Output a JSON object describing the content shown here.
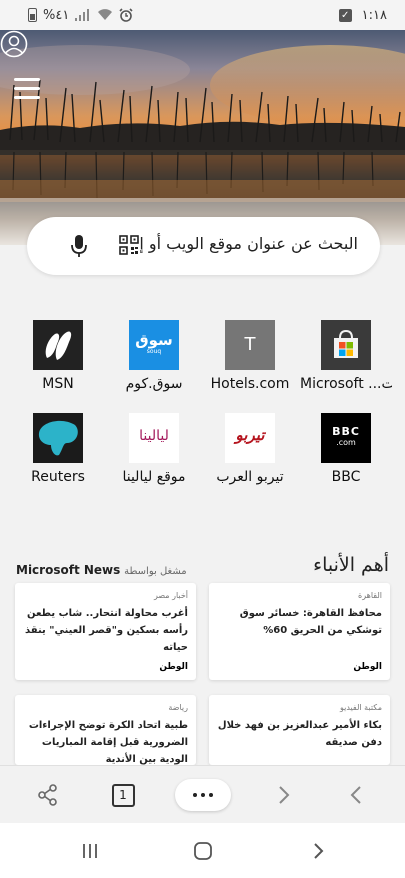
{
  "status_bar": {
    "battery_percent": "%٤١",
    "time": "١:١٨"
  },
  "search": {
    "placeholder": "البحث عن عنوان موقع الويب أو إ..."
  },
  "tiles": [
    {
      "label": "MSN",
      "icon": "msn-logo"
    },
    {
      "label": "سوق.كوم",
      "icon": "souq-logo",
      "logo_text": "سوق",
      "logo_sub": "souq"
    },
    {
      "label": "Hotels.com",
      "icon": "hotels-logo",
      "logo_text": "T"
    },
    {
      "label": "Microsoft ...ت",
      "icon": "microsoft-store-logo"
    },
    {
      "label": "Reuters",
      "icon": "reuters-logo"
    },
    {
      "label": "موقع ليالينا",
      "icon": "layalina-logo",
      "logo_text": "ليالينا"
    },
    {
      "label": "تيربو العرب",
      "icon": "turbo-logo",
      "logo_text": "تيربو"
    },
    {
      "label": "BBC",
      "icon": "bbc-logo",
      "logo_text": "BBC",
      "logo_sub": ".com"
    }
  ],
  "news": {
    "title": "أهم الأنباء",
    "provider_prefix": "مشغل بواسطة",
    "provider_name": "Microsoft News",
    "cards": [
      {
        "category": "القاهرة",
        "headline": "محافظ القاهرة: خسائر سوق توشكي من الحريق 60%",
        "source": "الوطن",
        "source_mark": "الوطن"
      },
      {
        "category": "أخبار مصر",
        "headline": "أغرب محاولة انتحار.. شاب يطعن رأسه بسكين و\"قصر العيني\" ينقذ حياته",
        "source": "الوطن",
        "source_mark": "الوطن"
      },
      {
        "category": "مكتبة الفيديو",
        "headline": "بكاء الأمير عبدالعزيز بن فهد خلال دفن صديقه",
        "source": "",
        "source_mark": ""
      },
      {
        "category": "رياضة",
        "headline": "طبية اتحاد الكرة توضح الإجراءات الضرورية قبل إقامة المباريات الودية بين الأندية",
        "source": "",
        "source_mark": ""
      }
    ]
  },
  "toolbar": {
    "tab_count": "1"
  },
  "colors": {
    "accent": "#0078d4",
    "souq_blue": "#1a8fe3",
    "reuters_teal": "#2cb3c9"
  }
}
